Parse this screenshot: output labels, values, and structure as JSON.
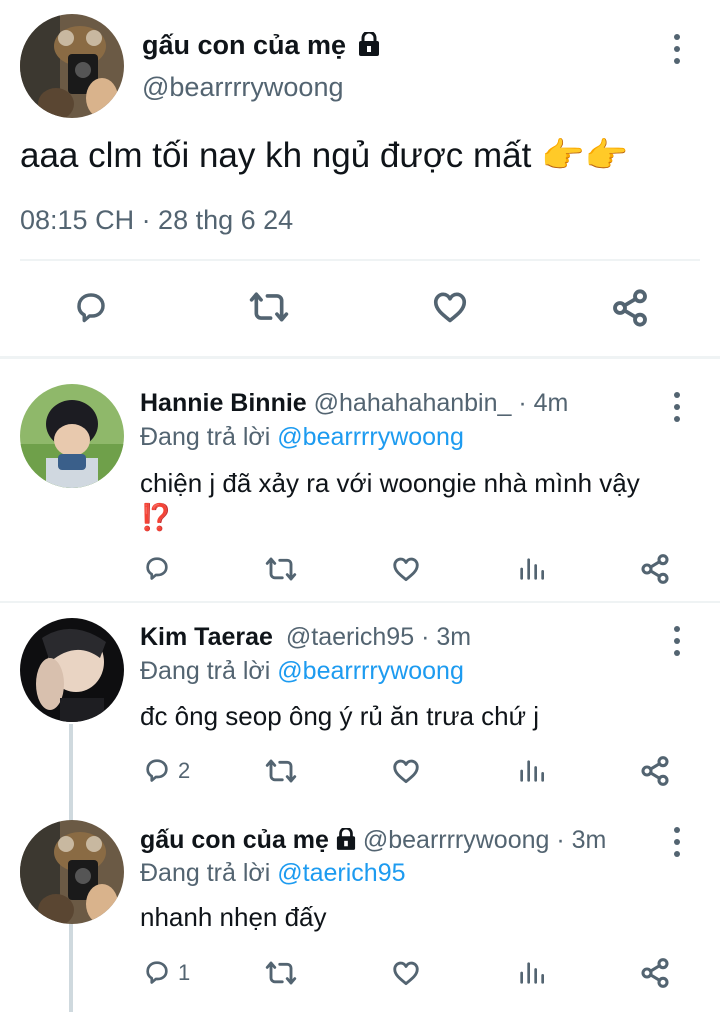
{
  "main_tweet": {
    "display_name": "gấu con của mẹ",
    "handle": "@bearrrrywoong",
    "text": "aaa clm tối nay kh ngủ được mất",
    "emoji": "👉👉",
    "timestamp": "08:15 CH · 28 thg 6 24",
    "icons": [
      "reply-icon",
      "retweet-icon",
      "like-icon",
      "share-icon"
    ]
  },
  "replies": [
    {
      "display_name": "Hannie Binnie",
      "handle": "@hahahahanbin_",
      "time": "· 4m",
      "replying_prefix": "Đang trả lời",
      "replying_to": "@bearrrrywoong",
      "text": "chiện j đã xảy ra với woongie nhà mình vậy",
      "emoji": "⁉️",
      "reply_count": ""
    },
    {
      "display_name": "Kim Taerae",
      "handle": "@taerich95",
      "time": "· 3m",
      "replying_prefix": "Đang trả lời",
      "replying_to": "@bearrrrywoong",
      "text": "đc ông seop ông ý rủ ăn trưa chứ j",
      "reply_count": "2"
    },
    {
      "display_name": "gấu con của mẹ",
      "handle": "@bearrrrywoong",
      "time": "· 3m",
      "replying_prefix": "Đang trả lời",
      "replying_to": "@taerich95",
      "text": "nhanh nhẹn đấy",
      "reply_count": "1"
    }
  ],
  "colors": {
    "link": "#1d9bf0",
    "muted": "#536471",
    "divider": "#eff3f4",
    "lock": "#0f1419"
  }
}
